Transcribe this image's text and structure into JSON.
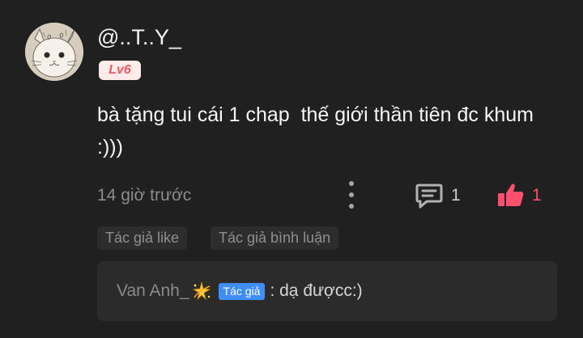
{
  "comment": {
    "username": "@..T..Y_",
    "level": "Lv6",
    "text": "bà tặng tui cái 1 chap  thế giới thần tiên đc khum :)))",
    "time": "14 giờ trước",
    "reply_count": "1",
    "like_count": "1"
  },
  "tags": {
    "author_like": "Tác giả like",
    "author_comment": "Tác giả bình luận"
  },
  "reply": {
    "author": "Van Anh_",
    "badge": "Tác giả",
    "text": ": dạ đượcc:)"
  },
  "icons": {
    "avatar": "cat-avatar",
    "more": "more-vertical-icon",
    "reply": "comment-icon",
    "like": "thumbs-up-icon",
    "sparkle": "dizzy-star-icon"
  },
  "colors": {
    "background": "#202020",
    "like_accent": "#ff4f6f",
    "level_badge_bg": "#fdebea",
    "level_badge_text": "#ef5a68",
    "author_badge_bg": "#3f8ef5"
  }
}
